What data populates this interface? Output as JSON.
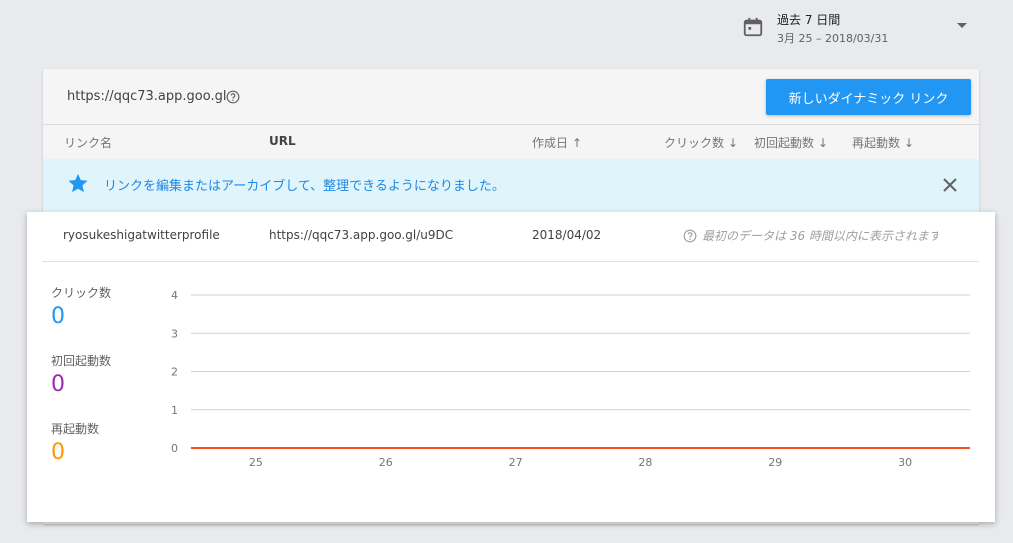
{
  "date_range": {
    "label": "過去 7 日間",
    "range": "3月 25 – 2018/03/31",
    "icon": "calendar-icon"
  },
  "card": {
    "domain": "https://qqc73.app.goo.gl",
    "new_link_button": "新しいダイナミック リンク",
    "columns": {
      "name": "リンク名",
      "url": "URL",
      "created": "作成日",
      "clicks": "クリック数",
      "first_opens": "初回起動数",
      "reopens": "再起動数"
    },
    "sort_icons": {
      "created": "↑",
      "clicks": "↓",
      "first_opens": "↓",
      "reopens": "↓"
    },
    "banner": "リンクを編集またはアーカイブして、整理できるようになりました。"
  },
  "row": {
    "name": "ryosukeshigatwitterprofile",
    "url": "https://qqc73.app.goo.gl/u9DC",
    "created": "2018/04/02",
    "status": "最初のデータは 36 時間以内に表示されます"
  },
  "metrics": [
    {
      "label": "クリック数",
      "value": "0",
      "color": "#2196f3"
    },
    {
      "label": "初回起動数",
      "value": "0",
      "color": "#9c27b0"
    },
    {
      "label": "再起動数",
      "value": "0",
      "color": "#ff9800"
    }
  ],
  "chart_data": {
    "type": "line",
    "x": [
      "25",
      "26",
      "27",
      "28",
      "29",
      "30"
    ],
    "ylim": [
      0,
      4
    ],
    "yticks": [
      "0",
      "1",
      "2",
      "3",
      "4"
    ],
    "grid": true,
    "series": [
      {
        "values": [
          0,
          0,
          0,
          0,
          0,
          0,
          0
        ],
        "color": "#f4511e"
      }
    ]
  }
}
